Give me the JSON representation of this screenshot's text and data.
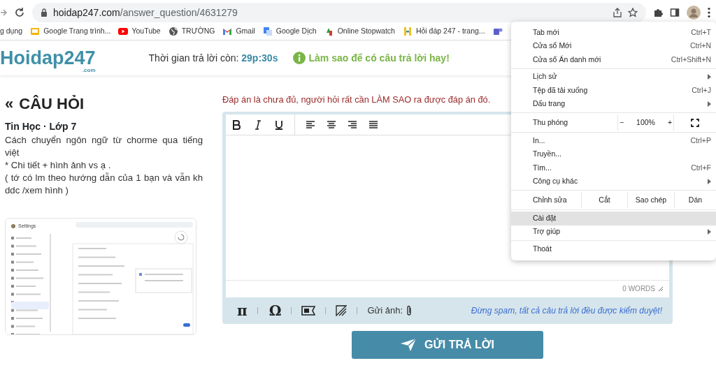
{
  "browser": {
    "url_host": "hoidap247.com",
    "url_path": "/answer_question/4631279",
    "bookmarks": [
      {
        "kind": "apps",
        "label": "g dụng"
      },
      {
        "kind": "slides",
        "label": "Google Trang trình..."
      },
      {
        "kind": "youtube",
        "label": "YouTube"
      },
      {
        "kind": "globe",
        "label": "TRƯỜNG"
      },
      {
        "kind": "gmail",
        "label": "Gmail"
      },
      {
        "kind": "translate",
        "label": "Google Dịch"
      },
      {
        "kind": "stopwatch",
        "label": "Online Stopwatch"
      },
      {
        "kind": "hoidap",
        "label": "Hỏi đáp 247 - trang..."
      },
      {
        "kind": "teams"
      }
    ]
  },
  "header": {
    "logo": "Hoidap247",
    "logo_suffix": ".com",
    "timer_label": "Thời gian trả lời còn:",
    "timer_value": "29p:30s",
    "help_link": "Làm sao để có câu trả lời hay!"
  },
  "question": {
    "back_glyph": "«",
    "heading": "CÂU HỎI",
    "subject": "Tin Học · Lớp 7",
    "lines": [
      "Cách chuyển ngôn ngữ từ chorme qua tiếng việt",
      "* Chi tiết + hình ảnh vs ạ .",
      "( tớ có lm theo hướng dẫn của 1 bạn và vẫn kh ddc /xem hình )"
    ],
    "attachment_title": "Settings"
  },
  "answer": {
    "notice": "Đáp án là chưa đủ, người hỏi rất cần LÀM SAO ra được đáp án đó.",
    "format_buttons": [
      {
        "kind": "bold"
      },
      {
        "kind": "italic"
      },
      {
        "kind": "underline"
      },
      {
        "kind": "align-left"
      },
      {
        "kind": "align-center"
      },
      {
        "kind": "align-right"
      },
      {
        "kind": "justify"
      }
    ],
    "word_count": "0 WORDS",
    "tools": [
      {
        "kind": "glyph",
        "label": "π"
      },
      {
        "kind": "glyph",
        "label": "Ω"
      },
      {
        "kind": "en"
      },
      {
        "kind": "draw"
      }
    ],
    "image_label": "Gửi ảnh:",
    "warning": "Đừng spam, tất cả câu trả lời đều được kiểm duyệt!",
    "submit": "GỬI TRẢ LỜI"
  },
  "menu": {
    "groups": [
      [
        {
          "kind": "item",
          "label": "Tab mới",
          "shortcut": "Ctrl+T",
          "submenu": false,
          "selected": false
        },
        {
          "kind": "item",
          "label": "Cửa sổ Mới",
          "shortcut": "Ctrl+N",
          "submenu": false,
          "selected": false
        },
        {
          "kind": "item",
          "label": "Cửa sổ Ẩn danh mới",
          "shortcut": "Ctrl+Shift+N",
          "submenu": false,
          "selected": false
        }
      ],
      [
        {
          "kind": "item",
          "label": "Lịch sử",
          "submenu": true,
          "selected": false
        },
        {
          "kind": "item",
          "label": "Tệp đã tải xuống",
          "shortcut": "Ctrl+J",
          "submenu": false,
          "selected": false
        },
        {
          "kind": "item",
          "label": "Dấu trang",
          "submenu": true,
          "selected": false
        }
      ],
      [
        {
          "kind": "zoom",
          "label": "Thu phóng",
          "minus": "−",
          "value": "100%",
          "plus": "+"
        }
      ],
      [
        {
          "kind": "item",
          "label": "In...",
          "shortcut": "Ctrl+P",
          "submenu": false,
          "selected": false
        },
        {
          "kind": "item",
          "label": "Truyền...",
          "submenu": false,
          "selected": false
        },
        {
          "kind": "item",
          "label": "Tìm...",
          "shortcut": "Ctrl+F",
          "submenu": false,
          "selected": false
        },
        {
          "kind": "item",
          "label": "Công cụ khác",
          "submenu": true,
          "selected": false
        }
      ],
      [
        {
          "kind": "edit",
          "label": "Chỉnh sửa",
          "buttons": [
            "Cắt",
            "Sao chép",
            "Dán"
          ]
        }
      ],
      [
        {
          "kind": "item",
          "label": "Cài đặt",
          "submenu": false,
          "selected": true
        },
        {
          "kind": "item",
          "label": "Trợ giúp",
          "submenu": true,
          "selected": false
        }
      ],
      [
        {
          "kind": "item",
          "label": "Thoát",
          "submenu": false,
          "selected": false
        }
      ]
    ]
  }
}
